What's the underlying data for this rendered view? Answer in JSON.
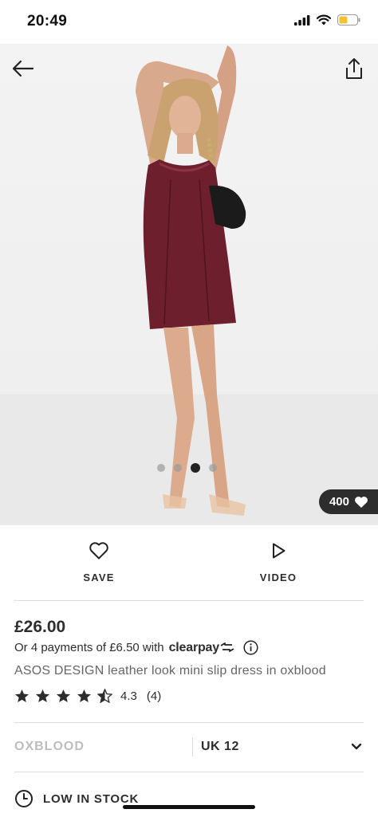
{
  "status_bar": {
    "time": "20:49"
  },
  "gallery": {
    "dots": [
      false,
      false,
      true,
      false
    ]
  },
  "likes": {
    "count": "400"
  },
  "actions": {
    "save_label": "SAVE",
    "video_label": "VIDEO"
  },
  "product": {
    "price": "£26.00",
    "payments_text": "Or 4 payments of £6.50 with",
    "provider": "clearpay",
    "title": "ASOS DESIGN leather look mini slip dress in oxblood",
    "rating_value": "4.3",
    "rating_count": "(4)",
    "rating_stars": 4.5
  },
  "selectors": {
    "colour": "OXBLOOD",
    "size": "UK 12"
  },
  "stock": {
    "label": "LOW IN STOCK"
  },
  "colors": {
    "accent": "#2d2d2d",
    "dress": "#6e1f2e"
  }
}
